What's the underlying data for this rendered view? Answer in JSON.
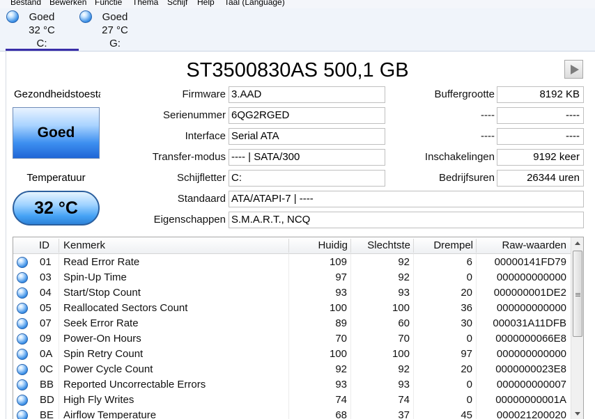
{
  "menu": [
    "Bestand",
    "Bewerken",
    "Functie",
    "Thema",
    "Schijf",
    "Help",
    "Taal (Language)"
  ],
  "drives": [
    {
      "status": "Goed",
      "temp": "32 °C",
      "letter": "C:"
    },
    {
      "status": "Goed",
      "temp": "27 °C",
      "letter": "G:"
    }
  ],
  "disk": {
    "title": "ST3500830AS 500,1 GB"
  },
  "health": {
    "heading": "Gezondheidstoestand",
    "value": "Goed"
  },
  "temperature": {
    "heading": "Temperatuur",
    "value": "32 °C"
  },
  "info": {
    "firmware_label": "Firmware",
    "firmware": "3.AAD",
    "serial_label": "Serienummer",
    "serial": "6QG2RGED",
    "interface_label": "Interface",
    "interface": "Serial ATA",
    "transfer_label": "Transfer-modus",
    "transfer": "---- | SATA/300",
    "letter_label": "Schijfletter",
    "letter": "C:",
    "standard_label": "Standaard",
    "standard": "ATA/ATAPI-7 | ----",
    "features_label": "Eigenschappen",
    "features": "S.M.A.R.T., NCQ",
    "buffer_label": "Buffergrootte",
    "buffer": "8192 KB",
    "blank1_label": "----",
    "blank1": "----",
    "blank2_label": "----",
    "blank2": "----",
    "power_on_count_label": "Inschakelingen",
    "power_on_count": "9192 keer",
    "power_on_hours_label": "Bedrijfsuren",
    "power_on_hours": "26344 uren"
  },
  "smart": {
    "headers": {
      "id": "ID",
      "attribute": "Kenmerk",
      "current": "Huidig",
      "worst": "Slechtste",
      "threshold": "Drempel",
      "raw": "Raw-waarden"
    },
    "rows": [
      {
        "id": "01",
        "name": "Read Error Rate",
        "current": "109",
        "worst": "92",
        "threshold": "6",
        "raw": "00000141FD79"
      },
      {
        "id": "03",
        "name": "Spin-Up Time",
        "current": "97",
        "worst": "92",
        "threshold": "0",
        "raw": "000000000000"
      },
      {
        "id": "04",
        "name": "Start/Stop Count",
        "current": "93",
        "worst": "93",
        "threshold": "20",
        "raw": "000000001DE2"
      },
      {
        "id": "05",
        "name": "Reallocated Sectors Count",
        "current": "100",
        "worst": "100",
        "threshold": "36",
        "raw": "000000000000"
      },
      {
        "id": "07",
        "name": "Seek Error Rate",
        "current": "89",
        "worst": "60",
        "threshold": "30",
        "raw": "000031A11DFB"
      },
      {
        "id": "09",
        "name": "Power-On Hours",
        "current": "70",
        "worst": "70",
        "threshold": "0",
        "raw": "0000000066E8"
      },
      {
        "id": "0A",
        "name": "Spin Retry Count",
        "current": "100",
        "worst": "100",
        "threshold": "97",
        "raw": "000000000000"
      },
      {
        "id": "0C",
        "name": "Power Cycle Count",
        "current": "92",
        "worst": "92",
        "threshold": "20",
        "raw": "0000000023E8"
      },
      {
        "id": "BB",
        "name": "Reported Uncorrectable Errors",
        "current": "93",
        "worst": "93",
        "threshold": "0",
        "raw": "000000000007"
      },
      {
        "id": "BD",
        "name": "High Fly Writes",
        "current": "74",
        "worst": "74",
        "threshold": "0",
        "raw": "00000000001A"
      },
      {
        "id": "BE",
        "name": "Airflow Temperature",
        "current": "68",
        "worst": "37",
        "threshold": "45",
        "raw": "000021200020"
      }
    ]
  },
  "colors": {
    "accent": "#3a2ea8",
    "status_blue": "#3d8ff0"
  },
  "icons": {
    "status": "blue-status-orb-icon",
    "next": "play-arrow-icon"
  }
}
